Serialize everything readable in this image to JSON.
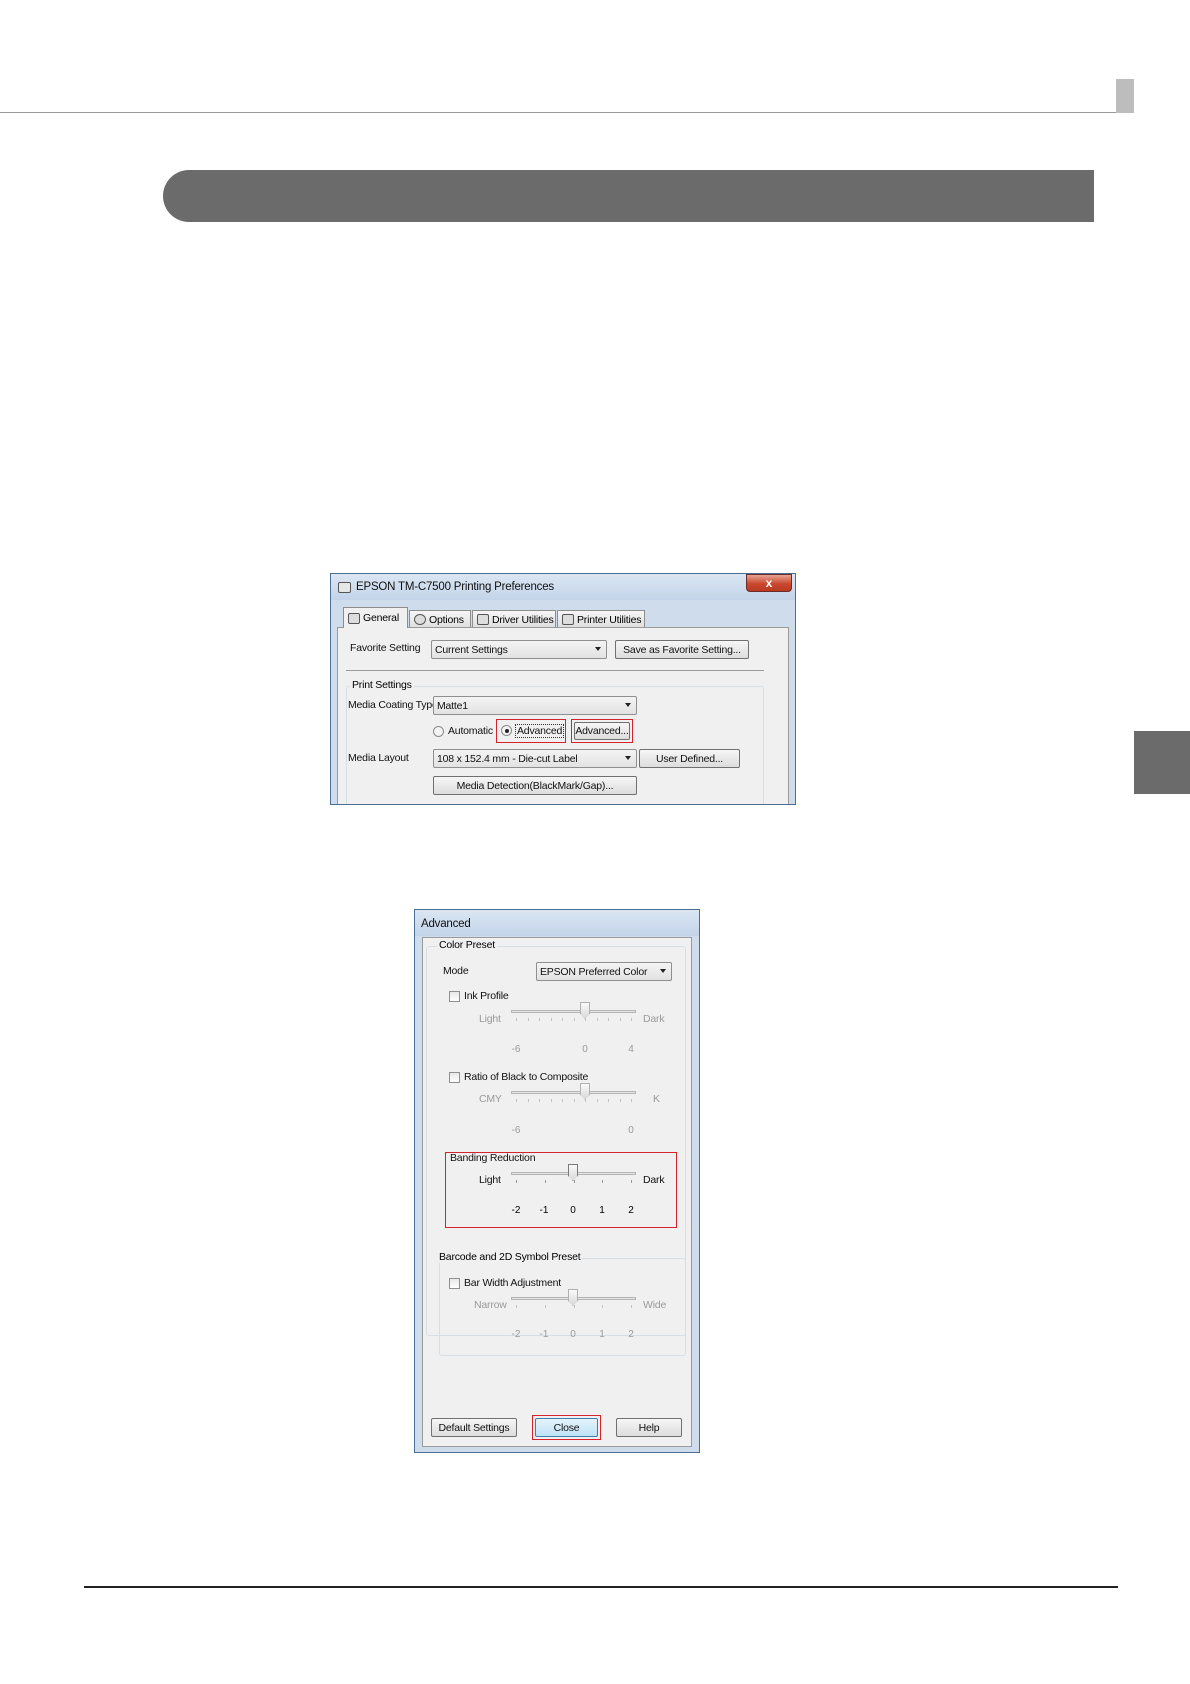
{
  "dialog1": {
    "title": "EPSON TM-C7500 Printing Preferences",
    "close_glyph": "x",
    "tabs": [
      {
        "label": "General"
      },
      {
        "label": "Options"
      },
      {
        "label": "Driver Utilities"
      },
      {
        "label": "Printer Utilities"
      }
    ],
    "favorite_label": "Favorite Setting",
    "favorite_value": "Current Settings",
    "save_favorite_button": "Save as Favorite Setting...",
    "print_settings_label": "Print Settings",
    "media_coating_label": "Media Coating Type",
    "media_coating_value": "Matte1",
    "automatic_label": "Automatic",
    "advanced_radio_label": "Advanced",
    "advanced_button": "Advanced...",
    "media_layout_label": "Media Layout",
    "media_layout_value": "108 x 152.4 mm - Die-cut Label",
    "user_defined_button": "User Defined...",
    "media_detection_button": "Media Detection(BlackMark/Gap)..."
  },
  "dialog2": {
    "title": "Advanced",
    "color_preset_label": "Color Preset",
    "mode_label": "Mode",
    "mode_value": "EPSON Preferred Color",
    "ink_profile": {
      "label": "Ink Profile",
      "left": "Light",
      "right": "Dark",
      "ticks": [
        "-6",
        "0",
        "4"
      ],
      "value": 0
    },
    "ratio": {
      "label": "Ratio of Black to Composite",
      "left": "CMY",
      "right": "K",
      "ticks": [
        "-6",
        "0"
      ],
      "value": 0
    },
    "banding": {
      "label": "Banding Reduction",
      "left": "Light",
      "right": "Dark",
      "ticks": [
        "-2",
        "-1",
        "0",
        "1",
        "2"
      ],
      "value": 0
    },
    "barcode_label": "Barcode and 2D Symbol Preset",
    "bar_width": {
      "label": "Bar Width Adjustment",
      "left": "Narrow",
      "right": "Wide",
      "ticks": [
        "-2",
        "-1",
        "0",
        "1",
        "2"
      ],
      "value": 0
    },
    "default_settings_button": "Default Settings",
    "close_button": "Close",
    "help_button": "Help"
  }
}
